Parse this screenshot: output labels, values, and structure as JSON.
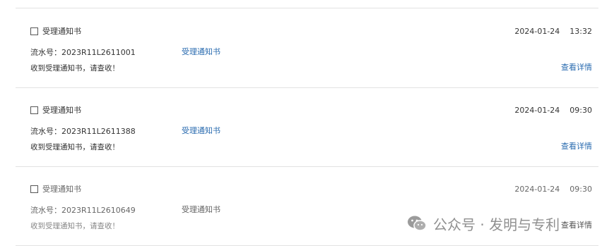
{
  "items": [
    {
      "title": "受理通知书",
      "date": "2024-01-24",
      "time": "13:32",
      "serial_label": "流水号：",
      "serial": "2023R11L2611001",
      "type_link": "受理通知书",
      "message": "收到受理通知书，请查收！",
      "detail_link": "查看详情"
    },
    {
      "title": "受理通知书",
      "date": "2024-01-24",
      "time": "09:30",
      "serial_label": "流水号：",
      "serial": "2023R11L2611388",
      "type_link": "受理通知书",
      "message": "收到受理通知书，请查收！",
      "detail_link": "查看详情"
    },
    {
      "title": "受理通知书",
      "date": "2024-01-24",
      "time": "09:30",
      "serial_label": "流水号：",
      "serial": "2023R11L2610649",
      "type_link": "受理通知书",
      "message": "收到受理通知书，请查收！",
      "detail_link": "查看详情"
    }
  ],
  "watermark": {
    "text": "公众号 · 发明与专利",
    "icon": "wechat-icon"
  }
}
